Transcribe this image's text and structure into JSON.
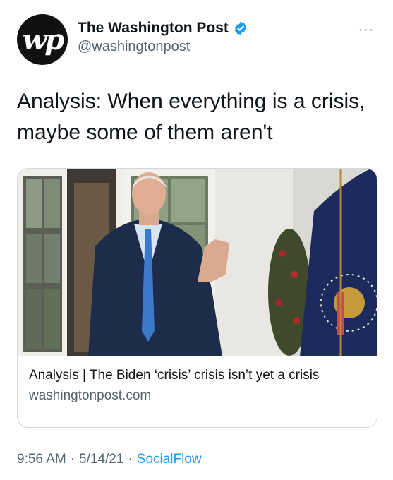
{
  "account": {
    "display_name": "The Washington Post",
    "handle": "@washingtonpost",
    "verified": true,
    "avatar_text": "wp"
  },
  "more_label": "···",
  "tweet": {
    "text": "Analysis: When everything is a crisis, maybe some of them aren't"
  },
  "link_card": {
    "title": "Analysis | The Biden ‘crisis’ crisis isn’t yet a crisis",
    "domain": "washingtonpost.com"
  },
  "meta": {
    "time": "9:56 AM",
    "separator": "·",
    "date": "5/14/21",
    "source": "SocialFlow"
  },
  "colors": {
    "verified_badge": "#1d9bf0",
    "secondary_text": "#536471",
    "link": "#1d9bf0"
  }
}
